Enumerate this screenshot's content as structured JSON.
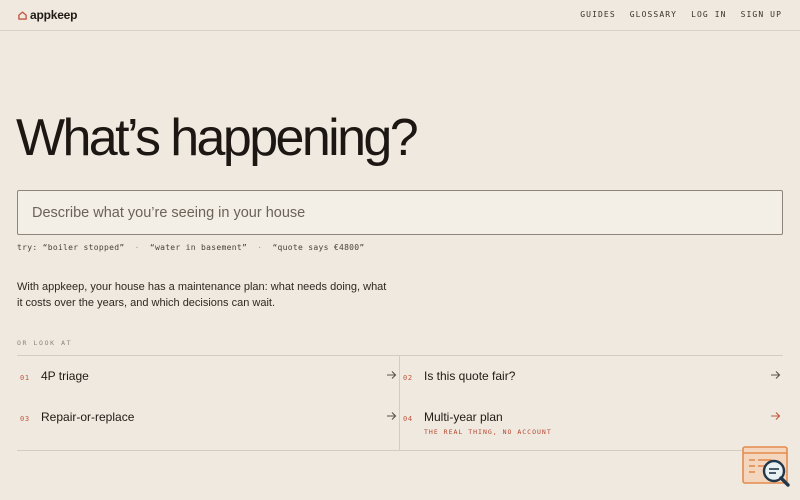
{
  "header": {
    "logo_text": "appkeep",
    "nav": [
      {
        "label": "GUIDES"
      },
      {
        "label": "GLOSSARY"
      },
      {
        "label": "LOG IN"
      },
      {
        "label": "SIGN UP"
      }
    ]
  },
  "hero": {
    "title": "What’s happening?",
    "search_placeholder": "Describe what you’re seeing in your house",
    "try_label": "try:",
    "suggestions": [
      "“boiler stopped”",
      "“water in basement”",
      "“quote says €4800”"
    ],
    "separator": "·"
  },
  "blurb": "With appkeep, your house has a maintenance plan: what needs doing, what it costs over the years, and which decisions can wait.",
  "or_look_at": "OR LOOK AT",
  "links": [
    {
      "num": "01",
      "label": "4P triage"
    },
    {
      "num": "02",
      "label": "Is this quote fair?"
    },
    {
      "num": "03",
      "label": "Repair-or-replace"
    },
    {
      "num": "04",
      "label": "Multi-year plan",
      "sub": "THE REAL THING, NO ACCOUNT"
    }
  ],
  "colors": {
    "background": "#efe9df",
    "text": "#1f1a15",
    "accent": "#c0583e",
    "accent_strong": "#b6452d",
    "helper_orange": "#e48b4d",
    "helper_navy": "#22384a"
  }
}
